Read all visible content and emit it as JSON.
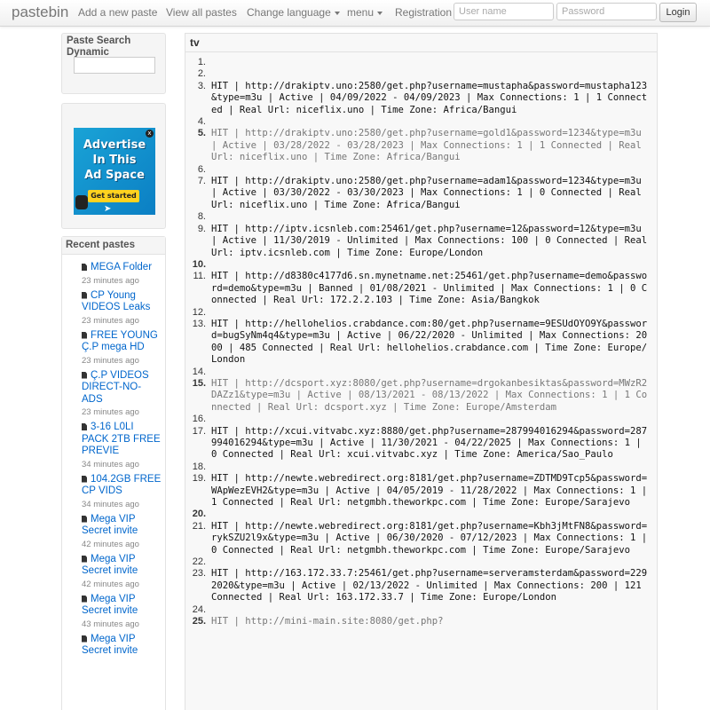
{
  "navbar": {
    "brand": "pastebin",
    "links": [
      "Add a new paste",
      "View all pastes",
      "Change language",
      "menu",
      "Registration"
    ],
    "username_placeholder": "User name",
    "password_placeholder": "Password",
    "login_label": "Login"
  },
  "sidebar": {
    "search_title": "Paste Search Dynamic",
    "ad": {
      "lines": [
        "Advertise",
        "In This",
        "Ad Space"
      ],
      "cta": "Get started",
      "close": "x"
    },
    "recent_title": "Recent pastes",
    "recent": [
      {
        "title": "MEGA Folder",
        "time": "23 minutes ago"
      },
      {
        "title": "CP Young VIDEOS Leaks",
        "time": "23 minutes ago"
      },
      {
        "title": "FREE YOUNG Ç.P mega HD",
        "time": "23 minutes ago"
      },
      {
        "title": "Ç.P VIDEOS DIRECT-NO-ADS",
        "time": "23 minutes ago"
      },
      {
        "title": "3-16 L0LI PACK 2TB FREE PREVIE",
        "time": "34 minutes ago"
      },
      {
        "title": "104.2GB FREE CP VIDS",
        "time": "34 minutes ago"
      },
      {
        "title": "Mega VIP Secret invite",
        "time": "42 minutes ago"
      },
      {
        "title": "Mega VIP Secret invite",
        "time": "42 minutes ago"
      },
      {
        "title": "Mega VIP Secret invite",
        "time": "43 minutes ago"
      },
      {
        "title": "Mega VIP Secret invite",
        "time": ""
      }
    ]
  },
  "paste": {
    "title": "tv",
    "lines": [
      {
        "num": "1.",
        "text": ""
      },
      {
        "num": "2.",
        "text": ""
      },
      {
        "num": "3.",
        "text": "HIT | http://drakiptv.uno:2580/get.php?username=mustapha&password=mustapha123&type=m3u | Active | 04/09/2022 - 04/09/2023 | Max Connections: 1 | 1 Connected | Real Url: niceflix.uno | Time Zone: Africa/Bangui"
      },
      {
        "num": "4.",
        "text": ""
      },
      {
        "num": "5.",
        "text": "HIT | http://drakiptv.uno:2580/get.php?username=gold1&password=1234&type=m3u | Active | 03/28/2022 - 03/28/2023 | Max Connections: 1 | 1 Connected | Real Url: niceflix.uno | Time Zone: Africa/Bangui"
      },
      {
        "num": "6.",
        "text": ""
      },
      {
        "num": "7.",
        "text": "HIT | http://drakiptv.uno:2580/get.php?username=adam1&password=1234&type=m3u | Active | 03/30/2022 - 03/30/2023 | Max Connections: 1 | 0 Connected | Real Url: niceflix.uno | Time Zone: Africa/Bangui"
      },
      {
        "num": "8.",
        "text": ""
      },
      {
        "num": "9.",
        "text": "HIT | http://iptv.icsnleb.com:25461/get.php?username=12&password=12&type=m3u | Active | 11/30/2019 - Unlimited | Max Connections: 100 | 0 Connected | Real Url: iptv.icsnleb.com | Time Zone: Europe/London"
      },
      {
        "num": "10.",
        "text": ""
      },
      {
        "num": "11.",
        "text": "HIT | http://d8380c4177d6.sn.mynetname.net:25461/get.php?username=demo&password=demo&type=m3u | Banned | 01/08/2021 - Unlimited | Max Connections: 1 | 0 Connected | Real Url: 172.2.2.103 | Time Zone: Asia/Bangkok"
      },
      {
        "num": "12.",
        "text": ""
      },
      {
        "num": "13.",
        "text": "HIT | http://hellohelios.crabdance.com:80/get.php?username=9ESUdOYO9Y&password=bugSyNm4q4&type=m3u | Active | 06/22/2020 - Unlimited | Max Connections: 2000 | 485 Connected | Real Url: hellohelios.crabdance.com | Time Zone: Europe/London"
      },
      {
        "num": "14.",
        "text": ""
      },
      {
        "num": "15.",
        "text": "HIT | http://dcsport.xyz:8080/get.php?username=drgokanbesiktas&password=MWzR2DAZz1&type=m3u | Active | 08/13/2021 - 08/13/2022 | Max Connections: 1 | 1 Connected | Real Url: dcsport.xyz | Time Zone: Europe/Amsterdam"
      },
      {
        "num": "16.",
        "text": ""
      },
      {
        "num": "17.",
        "text": "HIT | http://xcui.vitvabc.xyz:8880/get.php?username=287994016294&password=287994016294&type=m3u | Active | 11/30/2021 - 04/22/2025 | Max Connections: 1 | 0 Connected | Real Url: xcui.vitvabc.xyz | Time Zone: America/Sao_Paulo"
      },
      {
        "num": "18.",
        "text": ""
      },
      {
        "num": "19.",
        "text": "HIT | http://newte.webredirect.org:8181/get.php?username=ZDTMD9Tcp5&password=WApWezEVH2&type=m3u | Active | 04/05/2019 - 11/28/2022 | Max Connections: 1 | 1 Connected | Real Url: netgmbh.theworkpc.com | Time Zone: Europe/Sarajevo"
      },
      {
        "num": "20.",
        "text": ""
      },
      {
        "num": "21.",
        "text": "HIT | http://newte.webredirect.org:8181/get.php?username=Kbh3jMtFN8&password=rykSZU2l9x&type=m3u | Active | 06/30/2020 - 07/12/2023 | Max Connections: 1 | 0 Connected | Real Url: netgmbh.theworkpc.com | Time Zone: Europe/Sarajevo"
      },
      {
        "num": "22.",
        "text": ""
      },
      {
        "num": "23.",
        "text": "HIT | http://163.172.33.7:25461/get.php?username=serveramsterdam&password=2292020&type=m3u | Active | 02/13/2022 - Unlimited | Max Connections: 200 | 121 Connected | Real Url: 163.172.33.7 | Time Zone: Europe/London"
      },
      {
        "num": "24.",
        "text": ""
      },
      {
        "num": "25.",
        "text": "HIT | http://mini-main.site:8080/get.php?"
      }
    ]
  }
}
